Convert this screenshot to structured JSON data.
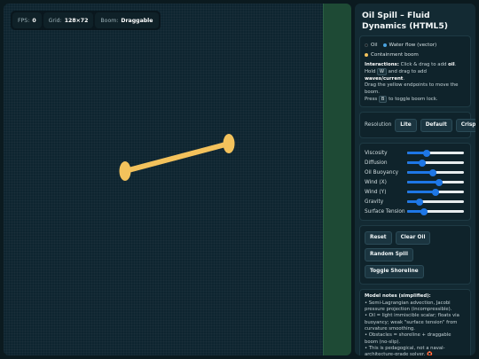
{
  "stats": {
    "fps_label": "FPS:",
    "fps_value": "0",
    "grid_label": "Grid:",
    "grid_value": "128×72",
    "boom_label": "Boom:",
    "boom_value": "Draggable"
  },
  "panel": {
    "title": "Oil Spill – Fluid Dynamics (HTML5)",
    "legend": {
      "oil": "Oil",
      "water": "Water flow (vector)",
      "boom": "Containment boom",
      "colors": {
        "oil": "#111418",
        "water": "#4aa3e0",
        "boom": "#f3c25c"
      }
    },
    "interactions": {
      "label": "Interactions:",
      "t1": "Click & drag to add",
      "oil": "oil",
      "t2": ". Hold",
      "key_w": "W",
      "t3": "and drag to add",
      "waves": "waves/current",
      "t4": ".",
      "t5": "Drag the yellow endpoints to move the boom.",
      "t6": "Press",
      "key_b": "B",
      "t7": "to toggle boom lock."
    },
    "resolution": {
      "label": "Resolution",
      "options": [
        "Lite",
        "Default",
        "Crisp"
      ]
    },
    "sliders": [
      {
        "label": "Viscosity",
        "value": 0.35
      },
      {
        "label": "Diffusion",
        "value": 0.27
      },
      {
        "label": "Oil Buoyancy",
        "value": 0.46
      },
      {
        "label": "Wind (X)",
        "value": 0.57
      },
      {
        "label": "Wind (Y)",
        "value": 0.5
      },
      {
        "label": "Gravity",
        "value": 0.22
      },
      {
        "label": "Surface Tension",
        "value": 0.3
      }
    ],
    "actions": {
      "reset": "Reset",
      "clear_oil": "Clear Oil",
      "random_spill": "Random Spill",
      "toggle_shoreline": "Toggle Shoreline"
    },
    "notes": {
      "heading": "Model notes (simplified):",
      "lines": [
        "• Semi-Lagrangian advection, Jacobi pressure projection (incompressible).",
        "• Oil = light immiscible scalar; floats via buoyancy; weak \"surface tension\" from curvature smoothing.",
        "• Obstacles = shoreline + draggable boom (no-slip).",
        "• This is pedagogical, not a naval-architecture-grade solver. 🛟"
      ]
    }
  },
  "colors": {
    "shoreline": "#1e4a35",
    "boom": "#f3c25c",
    "accent": "#1e77e6"
  }
}
